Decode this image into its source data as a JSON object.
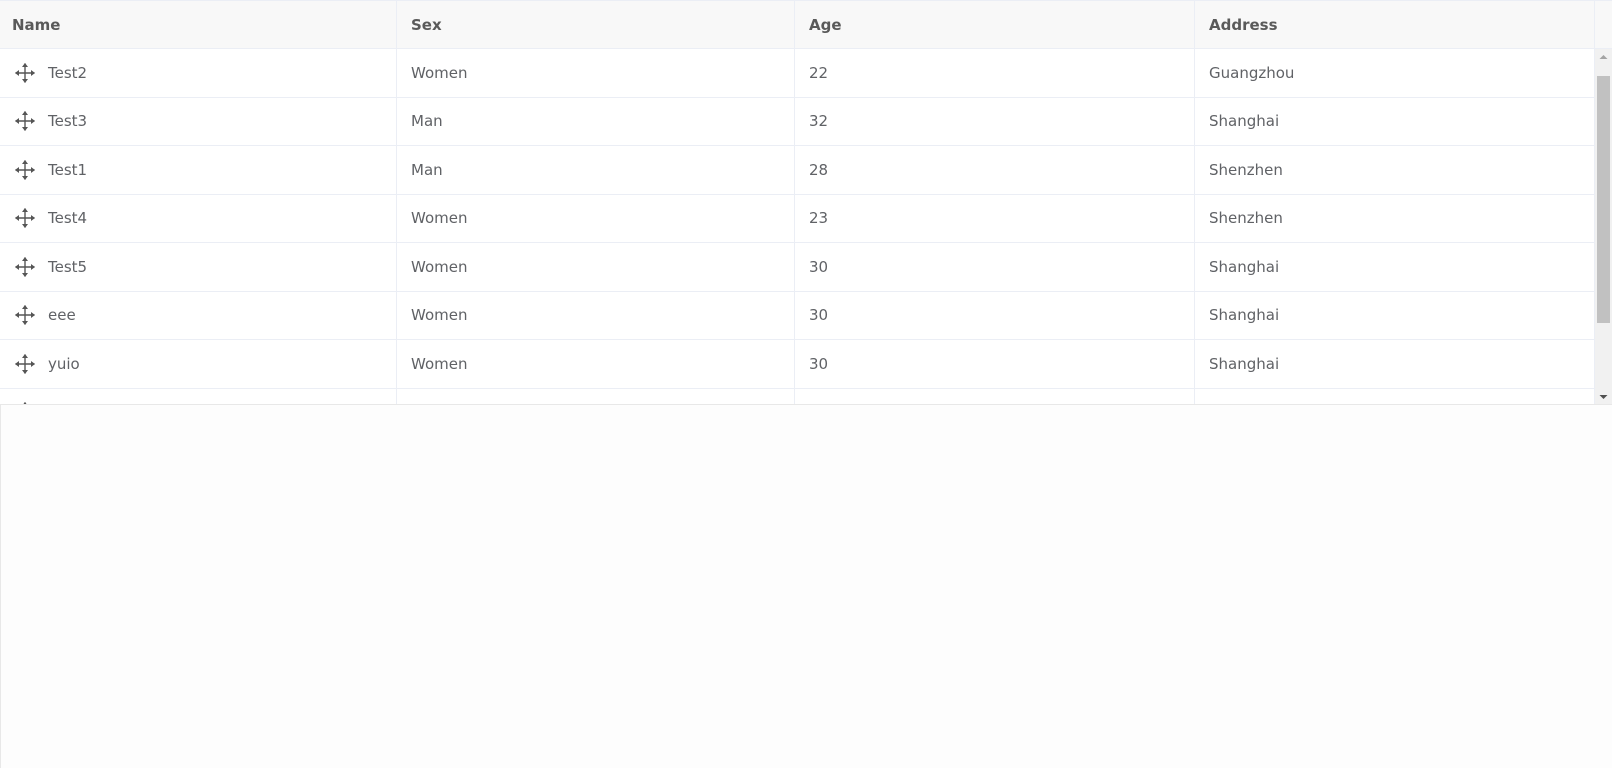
{
  "table": {
    "columns": [
      "Name",
      "Sex",
      "Age",
      "Address"
    ],
    "rows": [
      {
        "name": "Test2",
        "sex": "Women",
        "age": "22",
        "address": "Guangzhou"
      },
      {
        "name": "Test3",
        "sex": "Man",
        "age": "32",
        "address": "Shanghai"
      },
      {
        "name": "Test1",
        "sex": "Man",
        "age": "28",
        "address": "Shenzhen"
      },
      {
        "name": "Test4",
        "sex": "Women",
        "age": "23",
        "address": "Shenzhen"
      },
      {
        "name": "Test5",
        "sex": "Women",
        "age": "30",
        "address": "Shanghai"
      },
      {
        "name": "eee",
        "sex": "Women",
        "age": "30",
        "address": "Shanghai"
      },
      {
        "name": "yuio",
        "sex": "Women",
        "age": "30",
        "address": "Shanghai"
      },
      {
        "name": "",
        "sex": "",
        "age": "",
        "address": ""
      }
    ],
    "row_icon": "drag-move-icon"
  },
  "colors": {
    "header_bg": "#f8f8f8",
    "border": "#ebeef5",
    "text": "#606266",
    "scroll_thumb": "#c1c1c1"
  }
}
